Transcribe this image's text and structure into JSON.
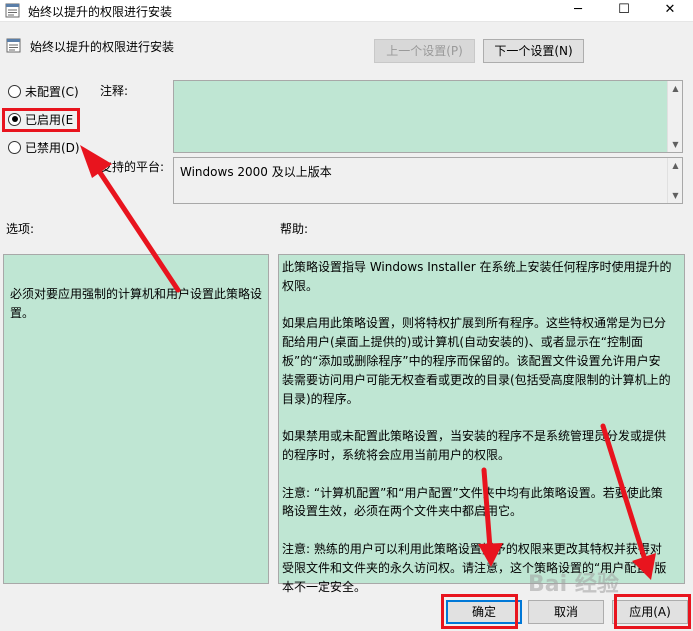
{
  "window": {
    "title": "始终以提升的权限进行安装",
    "minimize_glyph": "─",
    "maximize_glyph": "☐",
    "close_glyph": "✕"
  },
  "policy": {
    "title": "始终以提升的权限进行安装"
  },
  "nav": {
    "prev_label": "上一个设置(P)",
    "next_label": "下一个设置(N)"
  },
  "state": {
    "options": [
      {
        "label": "未配置(C)",
        "checked": false
      },
      {
        "label": "已启用(E",
        "checked": true
      },
      {
        "label": "已禁用(D)",
        "checked": false
      }
    ]
  },
  "labels": {
    "note": "注释:",
    "platform": "支持的平台:",
    "options": "选项:",
    "help": "帮助:"
  },
  "note_value": "",
  "platform_value": "Windows 2000 及以上版本",
  "options_text": "必须对要应用强制的计算机和用户设置此策略设置。",
  "help_paragraphs": [
    "此策略设置指导 Windows Installer 在系统上安装任何程序时使用提升的权限。",
    "如果启用此策略设置，则将特权扩展到所有程序。这些特权通常是为已分配给用户(桌面上提供的)或计算机(自动安装的)、或者显示在“控制面板”的“添加或删除程序”中的程序而保留的。该配置文件设置允许用户安装需要访问用户可能无权查看或更改的目录(包括受高度限制的计算机上的目录)的程序。",
    "如果禁用或未配置此策略设置，当安装的程序不是系统管理员分发或提供的程序时，系统将会应用当前用户的权限。",
    "注意: “计算机配置”和“用户配置”文件夹中均有此策略设置。若要使此策略设置生效，必须在两个文件夹中都启用它。",
    "注意: 熟练的用户可以利用此策略设置授予的权限来更改其特权并获得对受限文件和文件夹的永久访问权。请注意，这个策略设置的“用户配置”版本不一定安全。"
  ],
  "buttons": {
    "ok": "确定",
    "cancel": "取消",
    "apply": "应用(A)"
  },
  "watermark": "Bai 经验",
  "colors": {
    "field_bg": "#bfe6d3",
    "highlight": "#e8141e",
    "default_button_border": "#0078d7"
  }
}
